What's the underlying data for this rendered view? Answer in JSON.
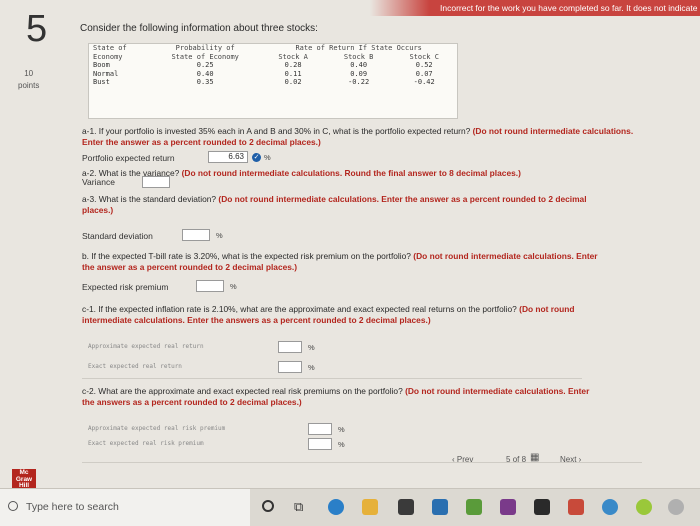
{
  "banner": {
    "text": "Incorrect for the work you have completed so far. It does not indicate"
  },
  "question": {
    "number": "5",
    "points_value": "10",
    "points_label": "points"
  },
  "intro": "Consider the following information about three stocks:",
  "table": {
    "header_row1": [
      "State of",
      "Probability of",
      "Rate of Return If State Occurs"
    ],
    "header_row2": [
      "Economy",
      "State of Economy",
      "Stock A",
      "Stock B",
      "Stock C"
    ],
    "rows": [
      [
        "Boom",
        "0.25",
        "0.28",
        "0.40",
        "0.52"
      ],
      [
        "Normal",
        "0.40",
        "0.11",
        "0.09",
        "0.07"
      ],
      [
        "Bust",
        "0.35",
        "0.02",
        "-0.22",
        "-0.42"
      ]
    ]
  },
  "a1": {
    "text": "a-1. If your portfolio is invested 35% each in A and B and 30% in C, what is the portfolio expected return?",
    "instruction": "(Do not round intermediate calculations. Enter the answer as a percent rounded to 2 decimal places.)",
    "label": "Portfolio expected return",
    "value": "6.63",
    "unit": "%"
  },
  "a2": {
    "text": "a-2. What is the variance?",
    "instruction": "(Do not round intermediate calculations. Round the final answer to 8 decimal places.)",
    "label": "Variance",
    "value": ""
  },
  "a3": {
    "text": "a-3. What is the standard deviation?",
    "instruction": "(Do not round intermediate calculations. Enter the answer as a percent rounded to 2 decimal places.)",
    "label": "Standard deviation",
    "value": "",
    "unit": "%"
  },
  "b": {
    "text": "b. If the expected T-bill rate is 3.20%, what is the expected risk premium on the portfolio?",
    "instruction": "(Do not round intermediate calculations. Enter the answer as a percent rounded to 2 decimal places.)",
    "label": "Expected risk premium",
    "value": "",
    "unit": "%"
  },
  "c1": {
    "text": "c-1. If the expected inflation rate is 2.10%, what are the approximate and exact expected real returns on the portfolio?",
    "instruction": "(Do not round intermediate calculations. Enter the answers as a percent rounded to 2 decimal places.)",
    "label_approx": "Approximate expected real return",
    "label_exact": "Exact expected real return",
    "unit": "%"
  },
  "c2": {
    "text": "c-2. What are the approximate and exact expected real risk premiums on the portfolio?",
    "instruction": "(Do not round intermediate calculations. Enter the answers as a percent rounded to 2 decimal places.)",
    "label_approx": "Approximate expected real risk premium",
    "label_exact": "Exact expected real risk premium",
    "unit": "%"
  },
  "nav": {
    "prev": "Prev",
    "page": "5",
    "of": "of",
    "total": "8",
    "next": "Next"
  },
  "logo": {
    "line1": "Mc",
    "line2": "Graw",
    "line3": "Hill"
  },
  "taskbar": {
    "search_placeholder": "Type here to search"
  },
  "colors": {
    "banner": "#c8443f",
    "accent_blue": "#1f5fa8",
    "instruction_red": "#b3261e"
  },
  "icons": [
    "search-icon",
    "cortana-icon",
    "task-view-icon",
    "edge-icon",
    "file-explorer-icon",
    "store-icon",
    "mail-icon",
    "app-icon"
  ]
}
